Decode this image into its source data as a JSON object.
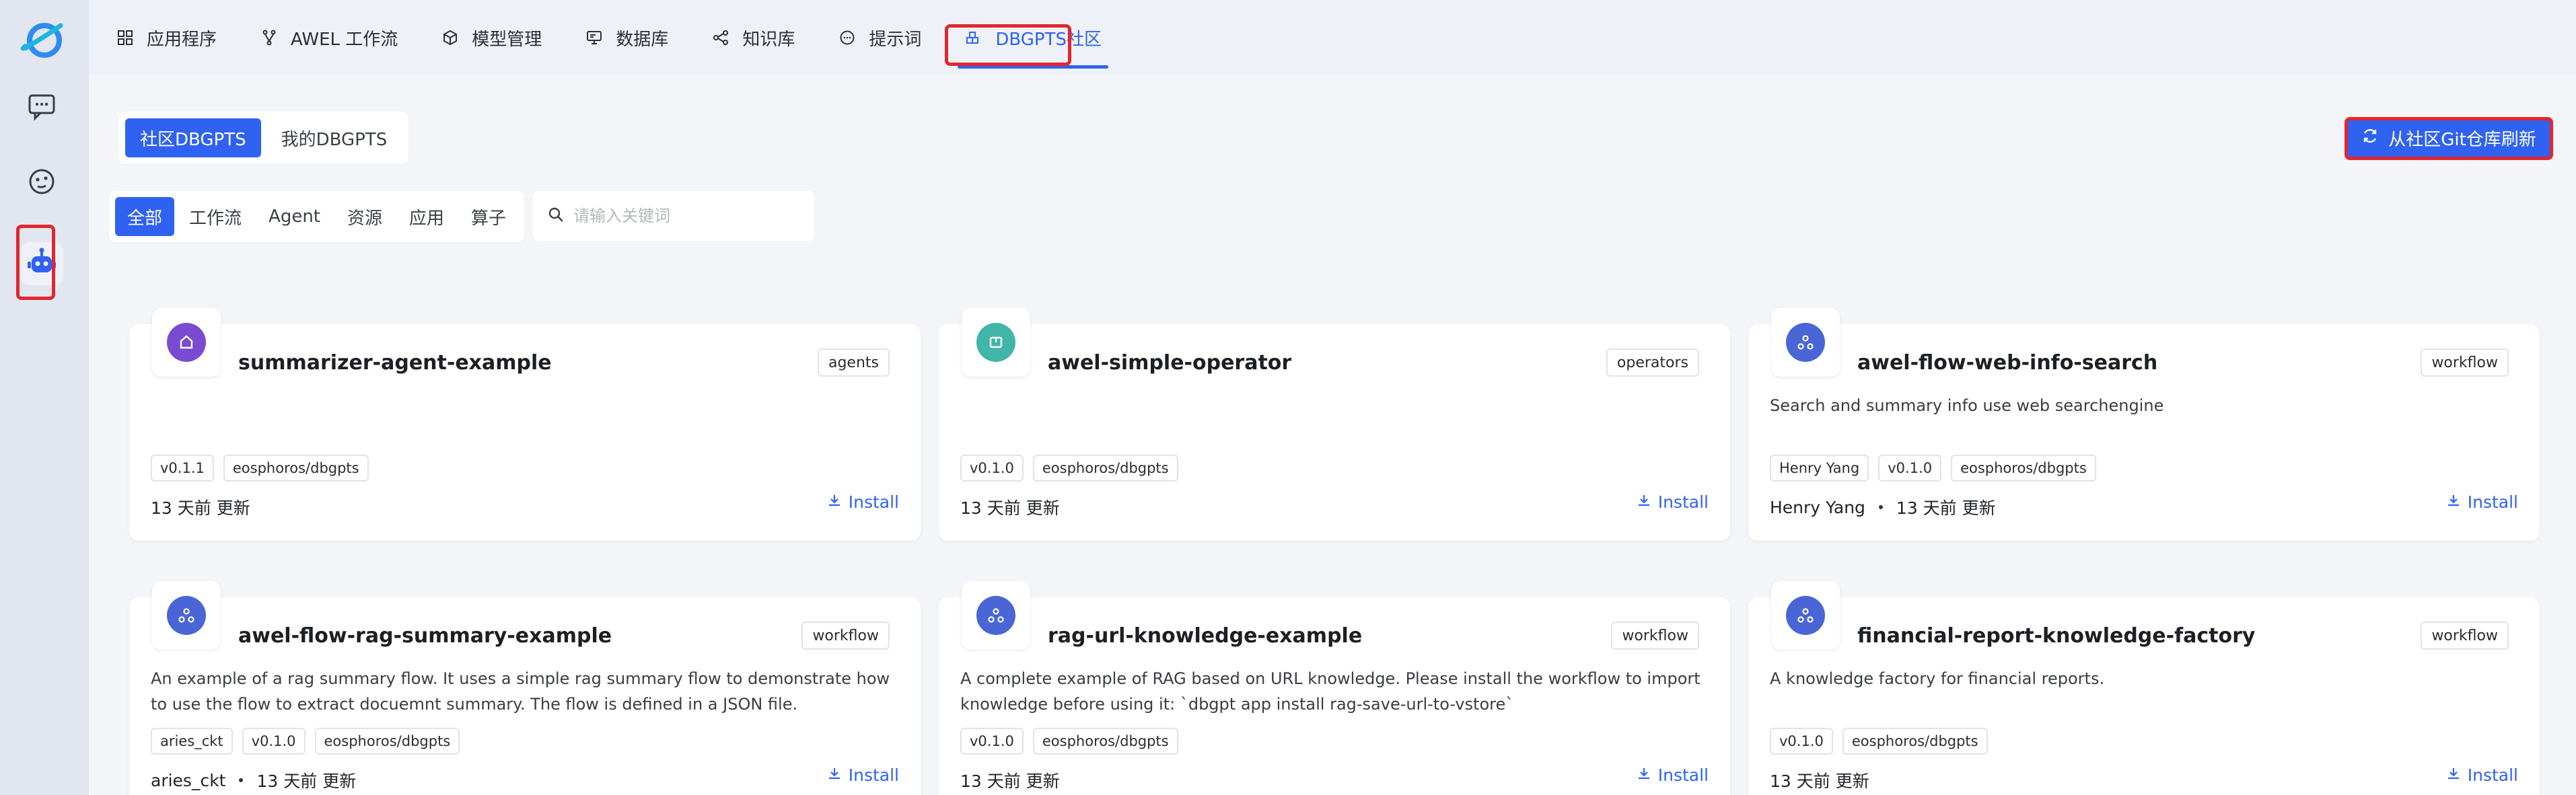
{
  "nav_tabs": [
    {
      "label": "应用程序",
      "icon": "grid-icon"
    },
    {
      "label": "AWEL 工作流",
      "icon": "branch-icon"
    },
    {
      "label": "模型管理",
      "icon": "cube-icon"
    },
    {
      "label": "数据库",
      "icon": "database-icon"
    },
    {
      "label": "知识库",
      "icon": "share-icon"
    },
    {
      "label": "提示词",
      "icon": "chat-icon"
    },
    {
      "label": "DBGPTS社区",
      "icon": "blocks-icon"
    }
  ],
  "segment": {
    "items": [
      "社区DBGPTS",
      "我的DBGPTS"
    ],
    "active": 0
  },
  "refresh_label": "从社区Git仓库刷新",
  "filters": {
    "items": [
      "全部",
      "工作流",
      "Agent",
      "资源",
      "应用",
      "算子"
    ],
    "active": 0
  },
  "search": {
    "placeholder": "请输入关键词",
    "value": ""
  },
  "cards": [
    {
      "name": "summarizer-agent-example",
      "type": "agents",
      "desc": "",
      "tags": [
        "v0.1.1",
        "eosphoros/dbgpts"
      ],
      "author": "",
      "updated": "13 天前 更新",
      "install": "Install",
      "color": "#7a4bd1"
    },
    {
      "name": "awel-simple-operator",
      "type": "operators",
      "desc": "",
      "tags": [
        "v0.1.0",
        "eosphoros/dbgpts"
      ],
      "author": "",
      "updated": "13 天前 更新",
      "install": "Install",
      "color": "#3fb6a8"
    },
    {
      "name": "awel-flow-web-info-search",
      "type": "workflow",
      "desc": "Search and summary info use web searchengine",
      "tags": [
        "Henry Yang",
        "v0.1.0",
        "eosphoros/dbgpts"
      ],
      "author": "Henry Yang",
      "updated": "13 天前 更新",
      "install": "Install",
      "color": "#4a66d6"
    },
    {
      "name": "awel-flow-rag-summary-example",
      "type": "workflow",
      "desc": "An example of a rag summary flow. It uses a simple rag summary flow to demonstrate how to use the flow to extract docuemnt summary. The flow is defined in a JSON file.",
      "tags": [
        "aries_ckt",
        "v0.1.0",
        "eosphoros/dbgpts"
      ],
      "author": "aries_ckt",
      "updated": "13 天前 更新",
      "install": "Install",
      "color": "#4a66d6"
    },
    {
      "name": "rag-url-knowledge-example",
      "type": "workflow",
      "desc": "A complete example of RAG based on URL knowledge. Please install the workflow to import knowledge before using it: `dbgpt app install rag-save-url-to-vstore`",
      "tags": [
        "v0.1.0",
        "eosphoros/dbgpts"
      ],
      "author": "",
      "updated": "13 天前 更新",
      "install": "Install",
      "color": "#4a66d6"
    },
    {
      "name": "financial-report-knowledge-factory",
      "type": "workflow",
      "desc": "A knowledge factory for financial reports.",
      "tags": [
        "v0.1.0",
        "eosphoros/dbgpts"
      ],
      "author": "",
      "updated": "13 天前 更新",
      "install": "Install",
      "color": "#4a66d6"
    }
  ]
}
